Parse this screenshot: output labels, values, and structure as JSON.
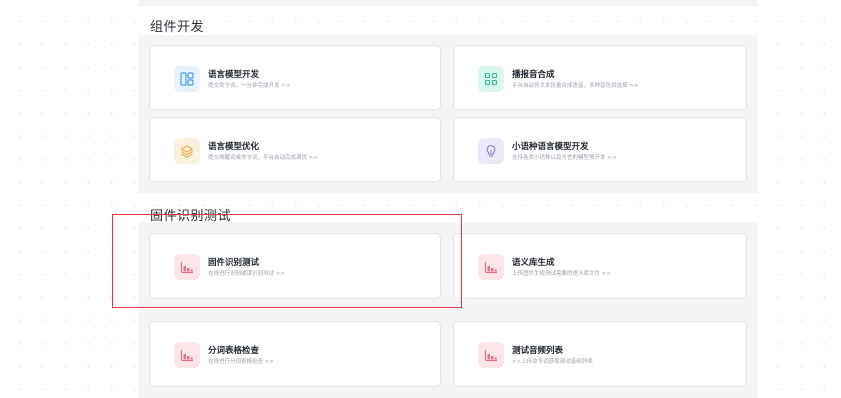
{
  "sections": {
    "component_dev": {
      "title": "组件开发",
      "cards": [
        {
          "title": "语言模型开发",
          "desc": "提交命令词，一分钟完成开发 >>"
        },
        {
          "title": "播报音合成",
          "desc": "平台自动将文本批量合成语音，多种音色供选择 >>"
        },
        {
          "title": "语言模型优化",
          "desc": "提交唤醒词或命令词，平台自动完成调优 >>"
        },
        {
          "title": "小语种语言模型开发",
          "desc": "支持各类小语种以及方言的模型预开发 >>"
        }
      ]
    },
    "firmware_test": {
      "title": "固件识别测试",
      "cards": [
        {
          "title": "固件识别测试",
          "desc": "在线进行识别或误识别测试 >>"
        },
        {
          "title": "语义库生成",
          "desc": "上传固件生成测试需要的语义库文件 >>"
        },
        {
          "title": "分词表格检查",
          "desc": "在线进行分词表格检查 >>"
        },
        {
          "title": "测试音频列表",
          "desc": ">>上传命令词获取测试音频列表"
        }
      ]
    }
  },
  "colors": {
    "icon_blue_bg": "#e6f2fd",
    "icon_blue_fg": "#4a9be6",
    "icon_green_bg": "#dcf7ef",
    "icon_green_fg": "#2fbf8f",
    "icon_orange_bg": "#fdf0df",
    "icon_orange_fg": "#f2a94b",
    "icon_purple_bg": "#ebe8f7",
    "icon_purple_fg": "#8a7fc4",
    "icon_pink_bg": "#fde6ea",
    "icon_pink_fg": "#ef6b80",
    "highlight_border": "#e23b3b"
  },
  "icons": [
    "layout-icon",
    "grid-icon",
    "layers-icon",
    "lightbulb-icon",
    "bar-chart-icon"
  ]
}
